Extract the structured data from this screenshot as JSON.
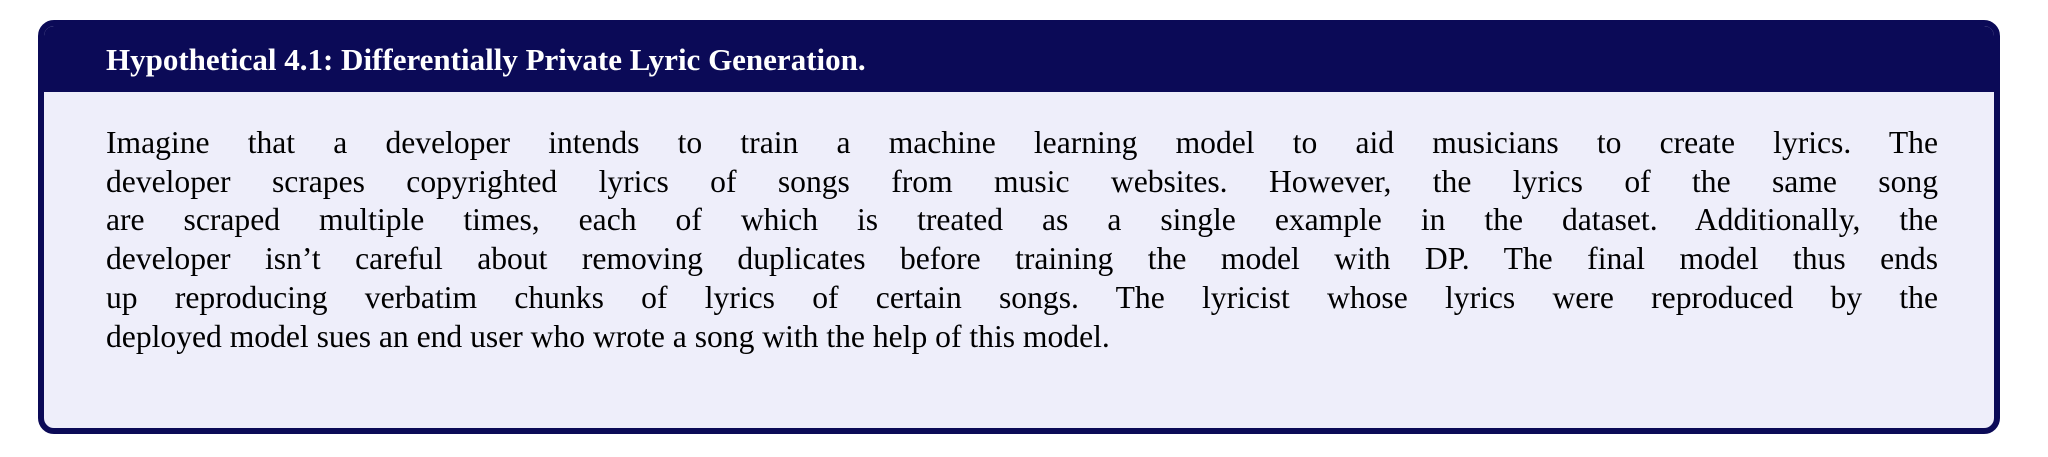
{
  "box": {
    "title": "Hypothetical 4.1: Differentially Private Lyric Generation.",
    "body_lines": [
      "Imagine that a developer intends to train a machine learning model to aid musicians to create lyrics.  The",
      "developer scrapes copyrighted lyrics of songs from music websites.  However, the lyrics of the same song",
      "are scraped multiple times, each of which is treated as a single example in the dataset.  Additionally, the",
      "developer isn’t careful about removing duplicates before training the model with DP. The final model thus ends",
      "up reproducing verbatim chunks of lyrics of certain songs. The lyricist whose lyrics were reproduced by the",
      "deployed model sues an end user who wrote a song with the help of this model."
    ]
  },
  "colors": {
    "frame": "#0b0a57",
    "background": "#eeeefa",
    "title_text": "#ffffff",
    "body_text": "#000000"
  }
}
